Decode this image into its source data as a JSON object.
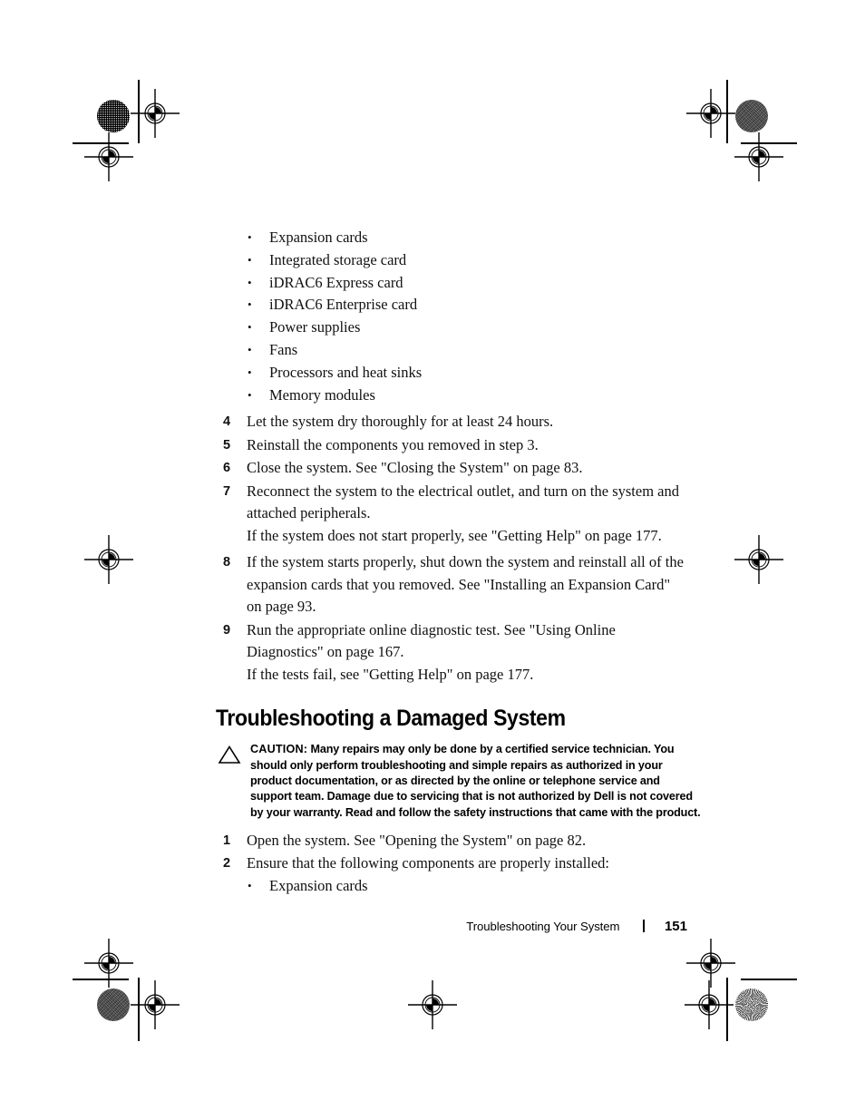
{
  "page": {
    "number": "151",
    "footer_title": "Troubleshooting Your System",
    "footer_separator": "|"
  },
  "content": {
    "top_bullets": [
      {
        "mark": "•",
        "text": "Expansion cards"
      },
      {
        "mark": "•",
        "text": "Integrated storage card"
      },
      {
        "mark": "•",
        "text": "iDRAC6 Express card"
      },
      {
        "mark": "•",
        "text": "iDRAC6 Enterprise card"
      },
      {
        "mark": "•",
        "text": "Power supplies"
      },
      {
        "mark": "•",
        "text": "Fans"
      },
      {
        "mark": "•",
        "text": "Processors and heat sinks"
      },
      {
        "mark": "•",
        "text": "Memory modules"
      }
    ],
    "steps": [
      {
        "num": "4",
        "text": "Let the system dry thoroughly for at least 24 hours."
      },
      {
        "num": "5",
        "text": "Reinstall the components you removed in step 3."
      },
      {
        "num": "6",
        "text": "Close the system. See \"Closing the System\" on page 83."
      },
      {
        "num": "7",
        "text": "Reconnect the system to the electrical outlet, and turn on the system and attached peripherals."
      }
    ],
    "note_after_7": "If the system does not start properly, see \"Getting Help\" on page 177.",
    "steps2": [
      {
        "num": "8",
        "text": "If the system starts properly, shut down the system and reinstall all of the expansion cards that you removed. See \"Installing an Expansion Card\" on page 93."
      },
      {
        "num": "9",
        "text": "Run the appropriate online diagnostic test. See \"Using Online Diagnostics\" on page 167."
      }
    ],
    "note_after_9": "If the tests fail, see \"Getting Help\" on page 177.",
    "section": {
      "heading": "Troubleshooting a Damaged System",
      "caution_label": "CAUTION:",
      "caution_text": "Many repairs may only be done by a certified service technician. You should only perform troubleshooting and simple repairs as authorized in your product documentation, or as directed by the online or telephone service and support team. Damage due to servicing that is not authorized by Dell is not covered by your warranty. Read and follow the safety instructions that came with the product."
    },
    "steps3": [
      {
        "num": "1",
        "text": "Open the system. See \"Opening the System\" on page 82."
      },
      {
        "num": "2",
        "text": "Ensure that the following components are properly installed:"
      }
    ],
    "bottom_bullets": [
      {
        "mark": "•",
        "text": "Expansion cards"
      }
    ]
  },
  "colors": {
    "text": "#000000",
    "background": "#ffffff"
  }
}
